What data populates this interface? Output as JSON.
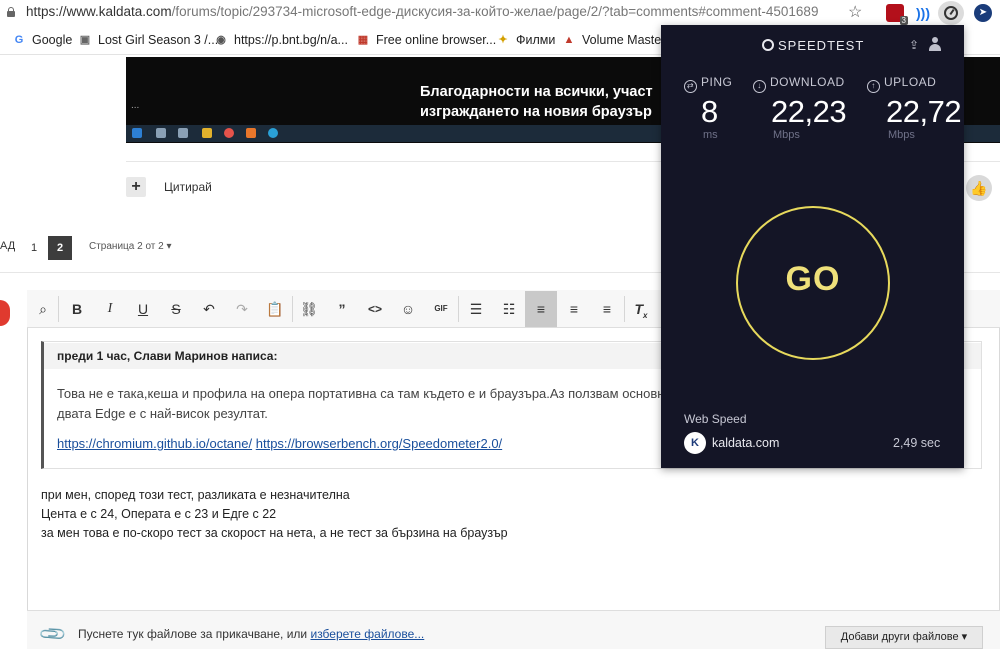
{
  "browser": {
    "url_main": "https://www.kaldata.com",
    "url_rest": "/forums/topic/293734-microsoft-edge-дискусия-за-който-желае/page/2/?tab=comments#comment-4501689",
    "ublock_badge": "3"
  },
  "bookmarks": [
    {
      "label": "Google",
      "icon": "G",
      "color": "#4285f4"
    },
    {
      "label": "Lost Girl Season 3 /...",
      "icon": "▣",
      "color": "#666"
    },
    {
      "label": "https://p.bnt.bg/n/a...",
      "icon": "◉",
      "color": "#555"
    },
    {
      "label": "Free online browser...",
      "icon": "▦",
      "color": "#c0392b"
    },
    {
      "label": "Филми",
      "icon": "✦",
      "color": "#d4a000"
    },
    {
      "label": "Volume Master -",
      "icon": "▲",
      "color": "#c0392b"
    }
  ],
  "video": {
    "line1": "Благодарности на всички, участ",
    "line2": "изграждането на новия браузър",
    "dots": "..."
  },
  "post": {
    "quote_action": "Цитирай",
    "plus": "+"
  },
  "pagination": {
    "prev": "АД",
    "page1": "1",
    "page2": "2",
    "info": "Страница 2 от 2 ▾"
  },
  "editor": {
    "quote_author": "преди 1 час, Слави Маринов написа:",
    "quote_line1": "Това не е така,кеша и профила на опера портативна са там където е и браузъра.Аз ползвам основн",
    "quote_line2": "двата Edge е с най-висок резултат.",
    "link1": "https://chromium.github.io/octane/",
    "link2": "https://browserbench.org/Speedometer2.0/",
    "reply_line1": "при мен, според този тест, разликата е незначителна",
    "reply_line2": "Цента е с 24, Операта е с 23 и Едге с 22",
    "reply_line3": "за мен това е по-скоро тест за скорост на нета, а не тест за бързина на браузър",
    "attach_text": "Пуснете тук файлове за прикачване, или ",
    "attach_link": "изберете файлове...",
    "add_files": "Добави други файлове ▾"
  },
  "speedtest": {
    "logo": "SPEEDTEST",
    "ping_label": "PING",
    "download_label": "DOWNLOAD",
    "upload_label": "UPLOAD",
    "ping": "8",
    "download": "22,23",
    "upload": "22,72",
    "ping_unit": "ms",
    "download_unit": "Mbps",
    "upload_unit": "Mbps",
    "go": "GO",
    "web_speed_label": "Web Speed",
    "host": "kaldata.com",
    "host_icon": "K",
    "time": "2,49 sec",
    "accent": "#e7d95c"
  }
}
